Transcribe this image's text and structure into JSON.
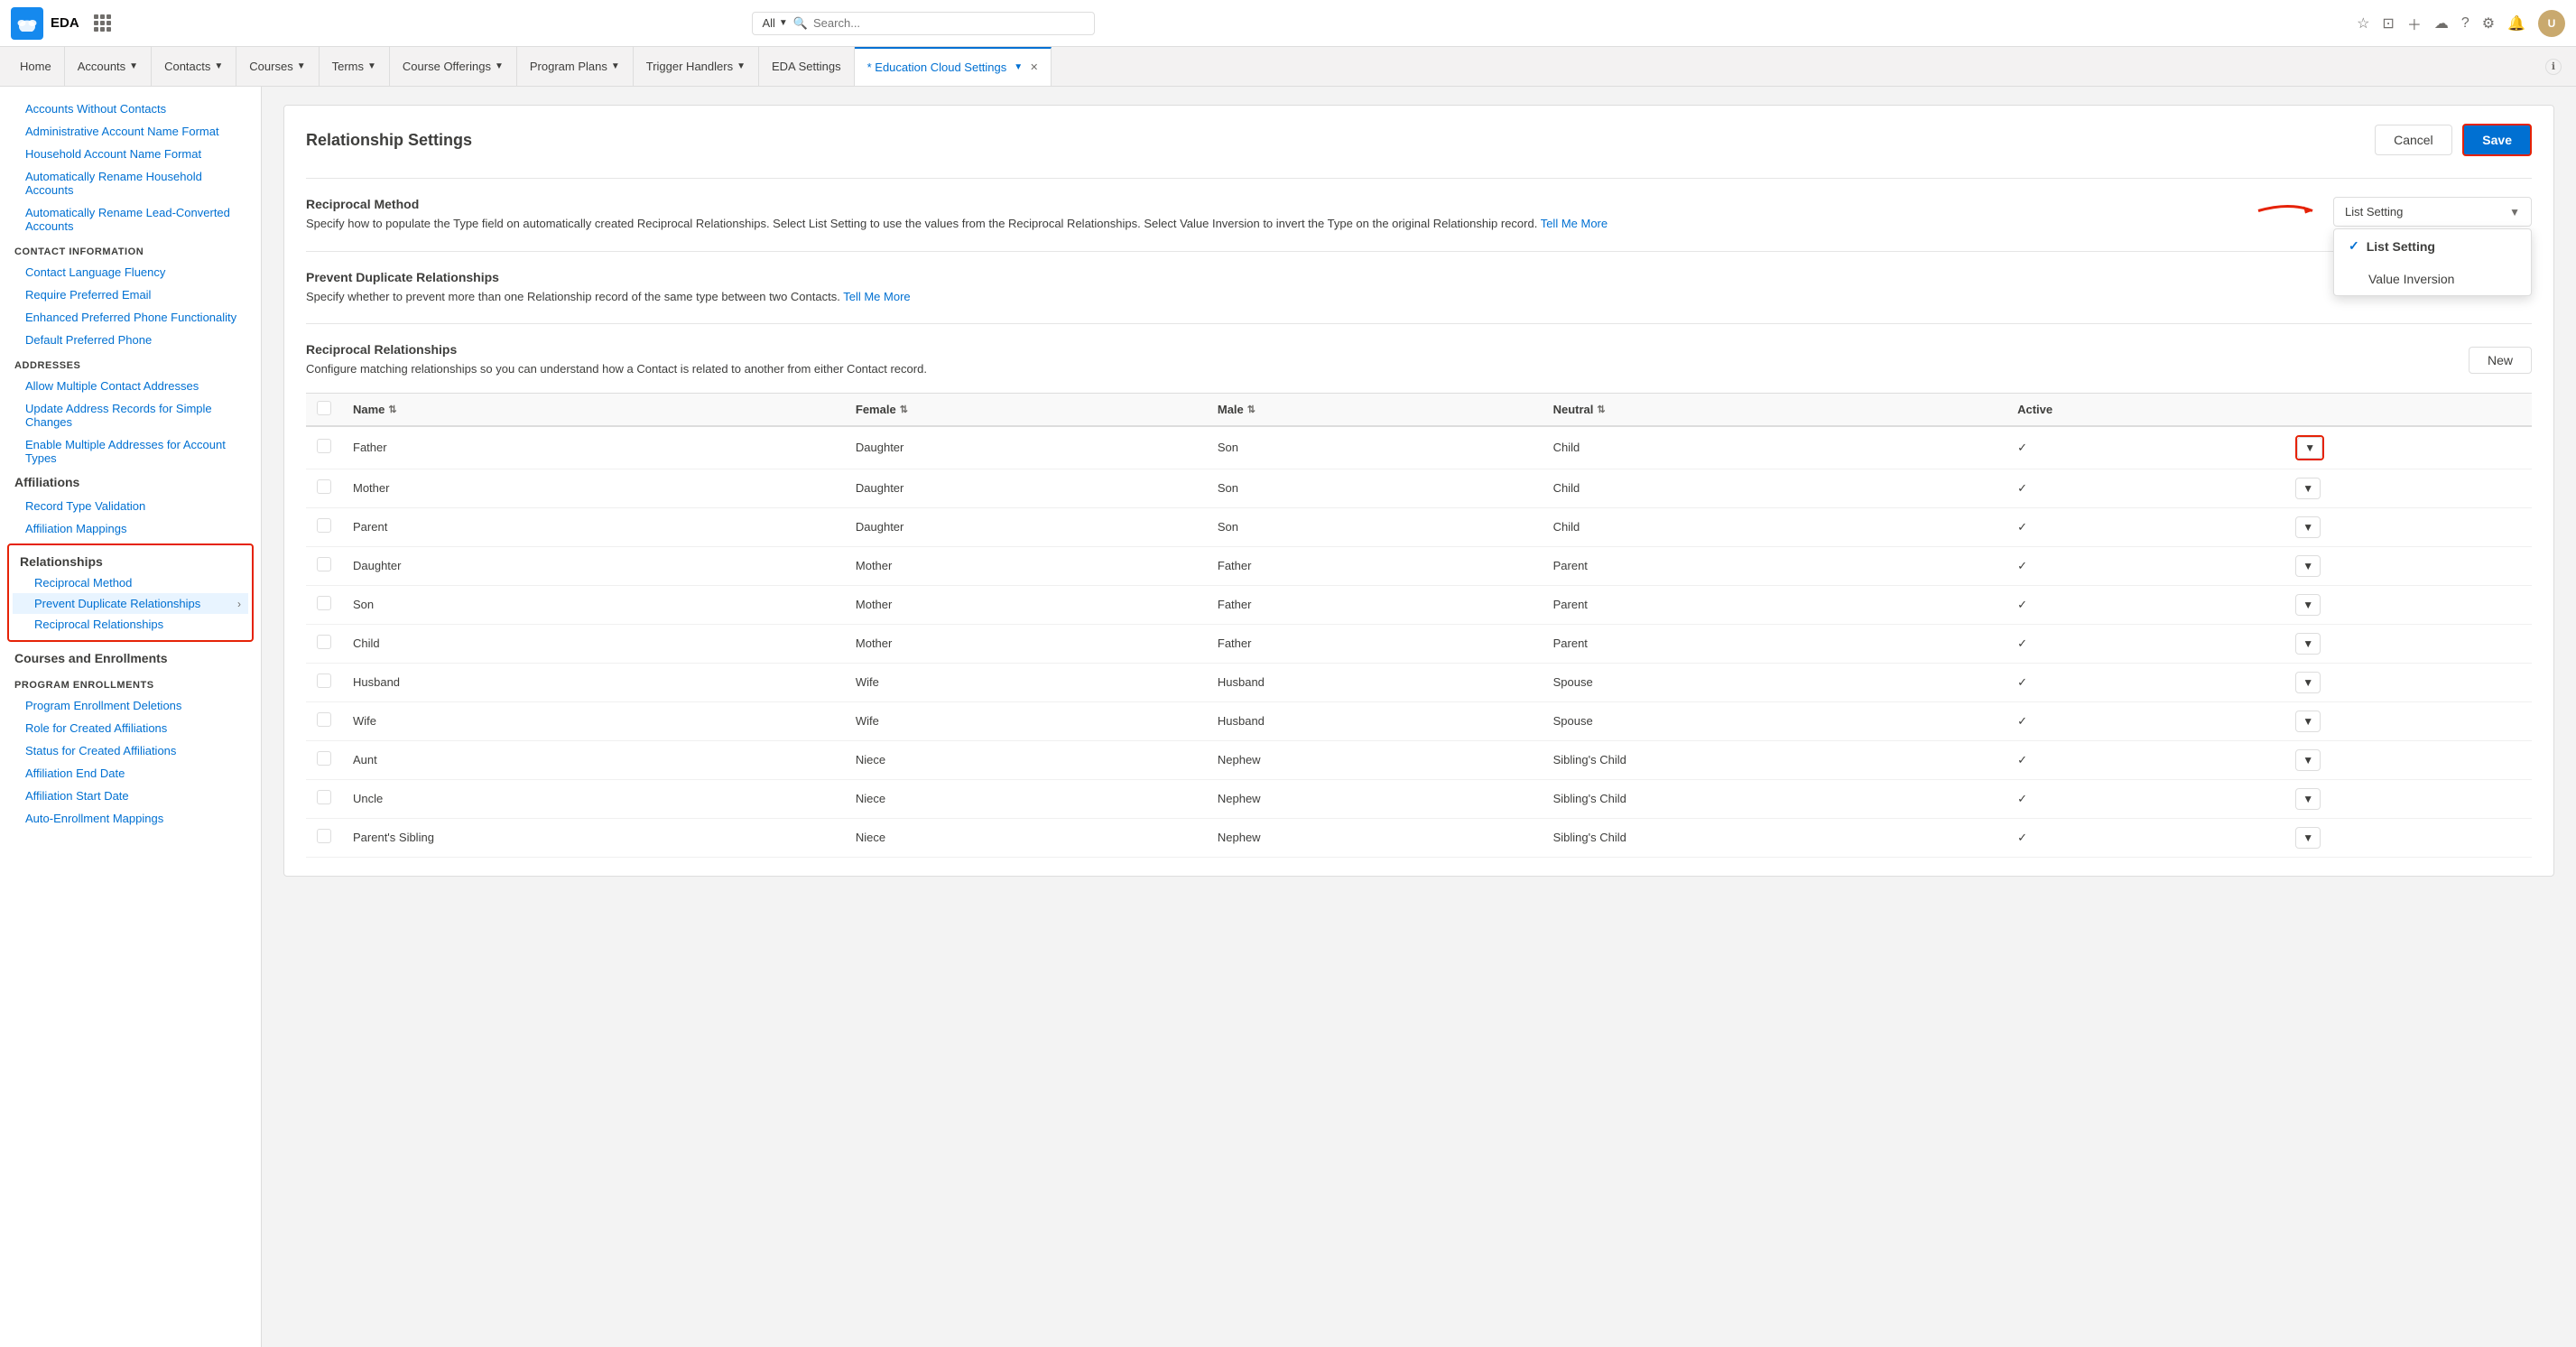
{
  "app": {
    "name": "EDA",
    "logo_text": "☁",
    "search_placeholder": "Search...",
    "search_scope": "All"
  },
  "nav_tabs": [
    {
      "label": "Home",
      "active": false,
      "has_dropdown": false
    },
    {
      "label": "Accounts",
      "active": false,
      "has_dropdown": true
    },
    {
      "label": "Contacts",
      "active": false,
      "has_dropdown": true
    },
    {
      "label": "Courses",
      "active": false,
      "has_dropdown": true
    },
    {
      "label": "Terms",
      "active": false,
      "has_dropdown": true
    },
    {
      "label": "Course Offerings",
      "active": false,
      "has_dropdown": true
    },
    {
      "label": "Program Plans",
      "active": false,
      "has_dropdown": true
    },
    {
      "label": "Trigger Handlers",
      "active": false,
      "has_dropdown": true
    },
    {
      "label": "EDA Settings",
      "active": false,
      "has_dropdown": false
    },
    {
      "label": "* Education Cloud Settings",
      "active": true,
      "has_dropdown": true,
      "closeable": true
    }
  ],
  "sidebar": {
    "top_items": [
      {
        "label": "Accounts Without Contacts",
        "section": null
      },
      {
        "label": "Administrative Account Name Format",
        "section": null
      },
      {
        "label": "Household Account Name Format",
        "section": null
      },
      {
        "label": "Automatically Rename Household Accounts",
        "section": null
      },
      {
        "label": "Automatically Rename Lead-Converted Accounts",
        "section": null
      }
    ],
    "sections": [
      {
        "title": "CONTACT INFORMATION",
        "items": [
          "Contact Language Fluency",
          "Require Preferred Email",
          "Enhanced Preferred Phone Functionality",
          "Default Preferred Phone"
        ]
      },
      {
        "title": "ADDRESSES",
        "items": [
          "Allow Multiple Contact Addresses",
          "Update Address Records for Simple Changes",
          "Enable Multiple Addresses for Account Types"
        ]
      }
    ],
    "affiliations": {
      "label": "Affiliations",
      "items": [
        "Record Type Validation",
        "Affiliation Mappings"
      ]
    },
    "relationships": {
      "label": "Relationships",
      "items": [
        {
          "label": "Reciprocal Method",
          "active": false,
          "has_arrow": false
        },
        {
          "label": "Prevent Duplicate Relationships",
          "active": true,
          "has_arrow": true
        },
        {
          "label": "Reciprocal Relationships",
          "active": false,
          "has_arrow": false
        }
      ]
    },
    "courses": {
      "label": "Courses and Enrollments",
      "sections": [
        {
          "title": "PROGRAM ENROLLMENTS",
          "items": [
            "Program Enrollment Deletions",
            "Role for Created Affiliations",
            "Status for Created Affiliations",
            "Affiliation End Date",
            "Affiliation Start Date",
            "Auto-Enrollment Mappings"
          ]
        }
      ]
    }
  },
  "main": {
    "title": "Relationship Settings",
    "cancel_label": "Cancel",
    "save_label": "Save",
    "sections": [
      {
        "key": "reciprocal_method",
        "label": "Reciprocal Method",
        "description": "Specify how to populate the Type field on automatically created Reciprocal Relationships. Select List Setting to use the values from the Reciprocal Relationships. Select Value Inversion to invert the Type on the original Relationship record.",
        "tell_me_more": "Tell Me More",
        "control_type": "dropdown",
        "dropdown": {
          "selected": "List Setting",
          "options": [
            "List Setting",
            "Value Inversion"
          ],
          "is_open": true
        }
      },
      {
        "key": "prevent_duplicate",
        "label": "Prevent Duplicate Relationships",
        "description": "Specify whether to prevent more than one Relationship record of the same type between two Contacts.",
        "tell_me_more": "Tell Me More",
        "control_type": "toggle",
        "toggle_on": true
      },
      {
        "key": "reciprocal_relationships",
        "label": "Reciprocal Relationships",
        "description": "Configure matching relationships so you can understand how a Contact is related to another from either Contact record.",
        "control_type": "table",
        "new_label": "New"
      }
    ],
    "table": {
      "columns": [
        {
          "key": "check",
          "label": "",
          "sortable": false
        },
        {
          "key": "name",
          "label": "Name",
          "sortable": true
        },
        {
          "key": "female",
          "label": "Female",
          "sortable": true
        },
        {
          "key": "male",
          "label": "Male",
          "sortable": true
        },
        {
          "key": "neutral",
          "label": "Neutral",
          "sortable": true
        },
        {
          "key": "active",
          "label": "Active",
          "sortable": false
        },
        {
          "key": "actions",
          "label": "",
          "sortable": false
        }
      ],
      "rows": [
        {
          "name": "Father",
          "female": "Daughter",
          "male": "Son",
          "neutral": "Child",
          "active": true,
          "highlighted": true
        },
        {
          "name": "Mother",
          "female": "Daughter",
          "male": "Son",
          "neutral": "Child",
          "active": true,
          "highlighted": false
        },
        {
          "name": "Parent",
          "female": "Daughter",
          "male": "Son",
          "neutral": "Child",
          "active": true,
          "highlighted": false
        },
        {
          "name": "Daughter",
          "female": "Mother",
          "male": "Father",
          "neutral": "Parent",
          "active": true,
          "highlighted": false
        },
        {
          "name": "Son",
          "female": "Mother",
          "male": "Father",
          "neutral": "Parent",
          "active": true,
          "highlighted": false
        },
        {
          "name": "Child",
          "female": "Mother",
          "male": "Father",
          "neutral": "Parent",
          "active": true,
          "highlighted": false
        },
        {
          "name": "Husband",
          "female": "Wife",
          "male": "Husband",
          "neutral": "Spouse",
          "active": true,
          "highlighted": false
        },
        {
          "name": "Wife",
          "female": "Wife",
          "male": "Husband",
          "neutral": "Spouse",
          "active": true,
          "highlighted": false
        },
        {
          "name": "Aunt",
          "female": "Niece",
          "male": "Nephew",
          "neutral": "Sibling's Child",
          "active": true,
          "highlighted": false
        },
        {
          "name": "Uncle",
          "female": "Niece",
          "male": "Nephew",
          "neutral": "Sibling's Child",
          "active": true,
          "highlighted": false
        },
        {
          "name": "Parent's Sibling",
          "female": "Niece",
          "male": "Nephew",
          "neutral": "Sibling's Child",
          "active": true,
          "highlighted": false
        }
      ]
    }
  }
}
